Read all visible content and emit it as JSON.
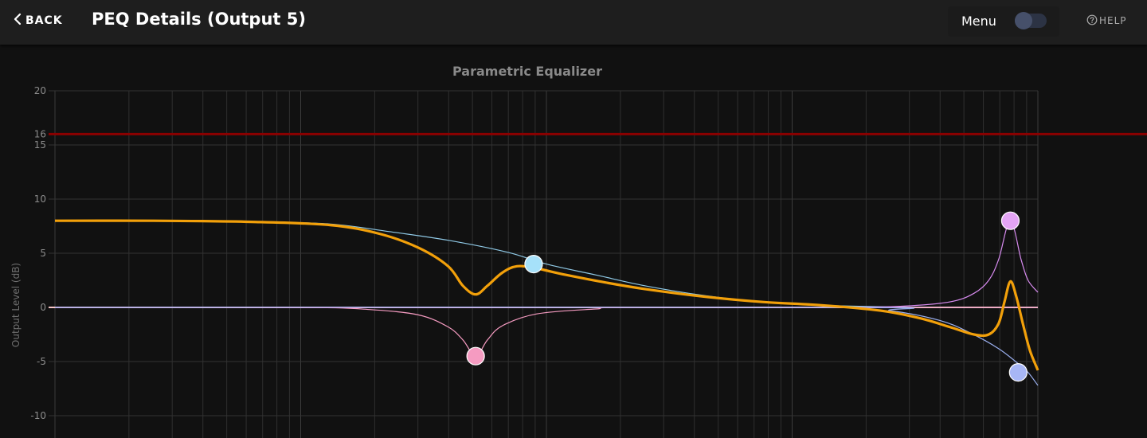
{
  "header": {
    "back_label": "BACK",
    "title": "PEQ Details (Output 5)",
    "menu_label": "Menu",
    "menu_toggle_on": false,
    "help_label": "HELP"
  },
  "icons": {
    "back": "chevron-left-icon",
    "help": "question-circle-icon"
  },
  "chart_data": {
    "type": "line",
    "title": "Parametric Equalizer",
    "ylabel": "Output Level (dB)",
    "xscale": "log",
    "ylim": [
      -12.5,
      20
    ],
    "yticks": [
      20,
      15,
      10,
      5,
      0,
      -5,
      -10
    ],
    "limit_line": {
      "label": "16",
      "value": 16,
      "color": "#8b0000"
    },
    "zero_line_color": "#f6c6c6",
    "grid": true,
    "series": [
      {
        "color": "#8fc9e6",
        "points": [
          [
            0,
            8
          ],
          [
            0.1,
            8
          ],
          [
            0.2,
            7.9
          ],
          [
            0.28,
            7.7
          ],
          [
            0.34,
            7
          ],
          [
            0.4,
            6.2
          ],
          [
            0.46,
            5.1
          ],
          [
            0.5,
            4
          ],
          [
            0.55,
            3
          ],
          [
            0.6,
            2
          ],
          [
            0.66,
            1.1
          ],
          [
            0.72,
            0.5
          ],
          [
            0.78,
            0.2
          ],
          [
            0.85,
            0.05
          ],
          [
            0.9,
            0
          ],
          [
            1,
            0
          ]
        ]
      },
      {
        "color": "#f59bc1",
        "points": [
          [
            0,
            0
          ],
          [
            0.25,
            0
          ],
          [
            0.32,
            -0.2
          ],
          [
            0.37,
            -0.7
          ],
          [
            0.4,
            -1.8
          ],
          [
            0.415,
            -3
          ],
          [
            0.428,
            -4.5
          ],
          [
            0.44,
            -3
          ],
          [
            0.455,
            -1.7
          ],
          [
            0.49,
            -0.6
          ],
          [
            0.55,
            -0.15
          ],
          [
            0.6,
            0
          ],
          [
            1,
            0
          ]
        ]
      },
      {
        "color": "#d88cf0",
        "points": [
          [
            0,
            0
          ],
          [
            0.7,
            0
          ],
          [
            0.8,
            0
          ],
          [
            0.86,
            0.1
          ],
          [
            0.91,
            0.5
          ],
          [
            0.935,
            1.3
          ],
          [
            0.95,
            2.5
          ],
          [
            0.96,
            4.4
          ],
          [
            0.972,
            8
          ],
          [
            0.983,
            4.4
          ],
          [
            0.99,
            2.5
          ],
          [
            1,
            1.4
          ]
        ]
      },
      {
        "color": "#9bb0f0",
        "points": [
          [
            0,
            0
          ],
          [
            0.8,
            0
          ],
          [
            0.85,
            -0.3
          ],
          [
            0.9,
            -1.2
          ],
          [
            0.93,
            -2.3
          ],
          [
            0.96,
            -3.8
          ],
          [
            0.98,
            -5.2
          ],
          [
            0.99,
            -6
          ],
          [
            1,
            -7.2
          ]
        ]
      },
      {
        "color": "#f2a00a",
        "points": [
          [
            0,
            8
          ],
          [
            0.1,
            8
          ],
          [
            0.2,
            7.9
          ],
          [
            0.28,
            7.6
          ],
          [
            0.33,
            6.8
          ],
          [
            0.37,
            5.5
          ],
          [
            0.4,
            3.8
          ],
          [
            0.415,
            2
          ],
          [
            0.428,
            1.2
          ],
          [
            0.44,
            2
          ],
          [
            0.455,
            3.2
          ],
          [
            0.47,
            3.8
          ],
          [
            0.49,
            3.6
          ],
          [
            0.52,
            3
          ],
          [
            0.56,
            2.3
          ],
          [
            0.6,
            1.7
          ],
          [
            0.66,
            1
          ],
          [
            0.72,
            0.5
          ],
          [
            0.78,
            0.2
          ],
          [
            0.84,
            -0.3
          ],
          [
            0.88,
            -1
          ],
          [
            0.91,
            -1.8
          ],
          [
            0.935,
            -2.5
          ],
          [
            0.95,
            -2.5
          ],
          [
            0.96,
            -1.5
          ],
          [
            0.966,
            0.5
          ],
          [
            0.972,
            2.4
          ],
          [
            0.978,
            1
          ],
          [
            0.985,
            -1.6
          ],
          [
            0.992,
            -4
          ],
          [
            1,
            -5.8
          ]
        ]
      }
    ],
    "markers": [
      {
        "name": "band-1-handle",
        "color": "#a6e1fa",
        "x": 0.487,
        "y": 4
      },
      {
        "name": "band-2-handle",
        "color": "#f59bc1",
        "x": 0.428,
        "y": -4.5
      },
      {
        "name": "band-3-handle",
        "color": "#e3a4f4",
        "x": 0.972,
        "y": 8
      },
      {
        "name": "band-4-handle",
        "color": "#a7b6f5",
        "x": 0.98,
        "y": -6
      }
    ]
  }
}
